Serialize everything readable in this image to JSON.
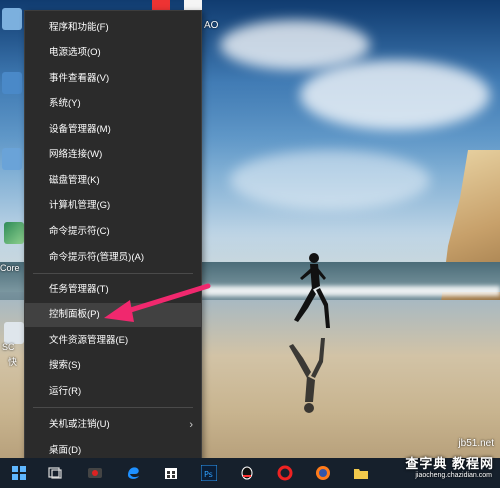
{
  "context_menu": {
    "items": [
      {
        "label": "程序和功能(F)"
      },
      {
        "label": "电源选项(O)"
      },
      {
        "label": "事件查看器(V)"
      },
      {
        "label": "系统(Y)"
      },
      {
        "label": "设备管理器(M)"
      },
      {
        "label": "网络连接(W)"
      },
      {
        "label": "磁盘管理(K)"
      },
      {
        "label": "计算机管理(G)"
      },
      {
        "label": "命令提示符(C)"
      },
      {
        "label": "命令提示符(管理员)(A)"
      },
      {
        "label": "任务管理器(T)"
      },
      {
        "label": "控制面板(P)",
        "highlighted": true
      },
      {
        "label": "文件资源管理器(E)"
      },
      {
        "label": "搜索(S)"
      },
      {
        "label": "运行(R)"
      },
      {
        "label": "关机或注销(U)",
        "has_submenu": true
      },
      {
        "label": "桌面(D)"
      }
    ]
  },
  "desktop": {
    "left_labels": [
      "Core",
      "SC",
      "快"
    ],
    "top_label": "AO"
  },
  "watermark": {
    "url": "jb51.net",
    "main": "查字典 教程网",
    "sub": "jiaocheng.chazidian.com"
  },
  "colors": {
    "menu_bg": "#2b2b2b",
    "menu_hover": "#414141",
    "arrow": "#f0286e",
    "taskbar": "#16202c"
  },
  "taskbar": {
    "icons": [
      "windows-start-icon",
      "task-view-icon",
      "app-icon",
      "edge-icon",
      "store-icon",
      "photoshop-icon",
      "qq-icon",
      "app-red-icon",
      "firefox-icon",
      "file-explorer-icon"
    ]
  }
}
